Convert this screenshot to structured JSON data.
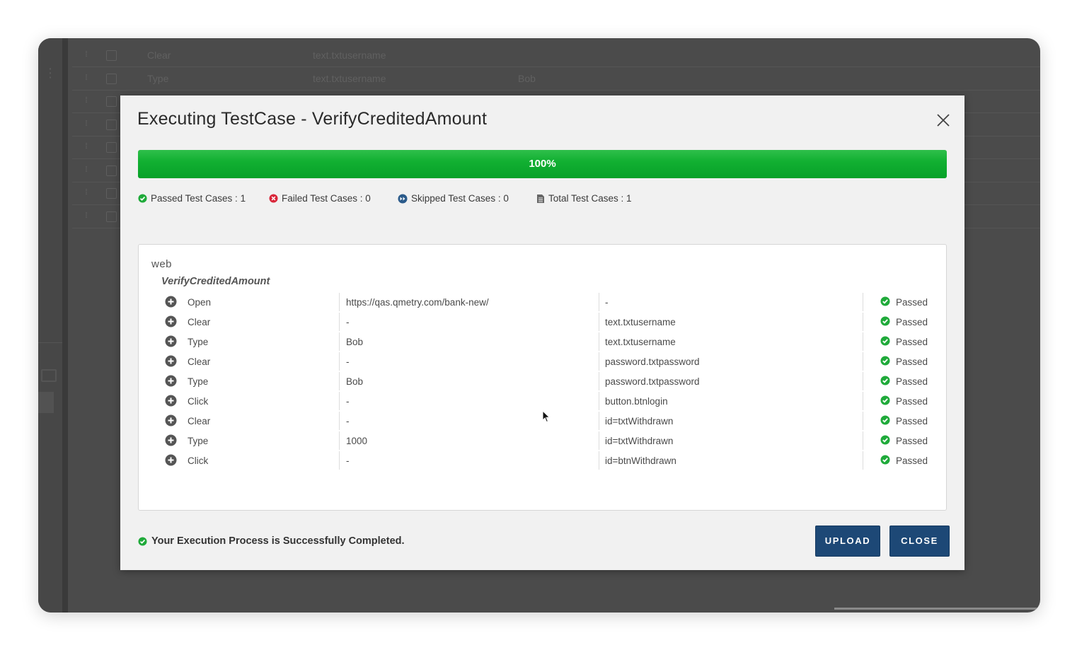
{
  "background": {
    "rows": [
      {
        "action": "Clear",
        "locator": "text.txtusername",
        "value": ""
      },
      {
        "action": "Type",
        "locator": "text.txtusername",
        "value": "Bob"
      },
      {
        "action": "",
        "locator": "",
        "value": ""
      },
      {
        "action": "",
        "locator": "",
        "value": ""
      },
      {
        "action": "",
        "locator": "",
        "value": ""
      },
      {
        "action": "",
        "locator": "",
        "value": ""
      },
      {
        "action": "",
        "locator": "",
        "value": ""
      },
      {
        "action": "",
        "locator": "",
        "value": ""
      }
    ]
  },
  "modal": {
    "title": "Executing TestCase - VerifyCreditedAmount",
    "progress": {
      "percent": 100,
      "label": "100%",
      "color": "#12b032"
    },
    "stats": {
      "passed": "Passed Test Cases : 1",
      "failed": "Failed Test Cases : 0",
      "skipped": "Skipped Test Cases : 0",
      "total": "Total Test Cases : 1"
    },
    "results": {
      "suite": "web",
      "testcase": "VerifyCreditedAmount",
      "steps": [
        {
          "action": "Open",
          "value": "https://qas.qmetry.com/bank-new/",
          "locator": "-",
          "status": "Passed"
        },
        {
          "action": "Clear",
          "value": "-",
          "locator": "text.txtusername",
          "status": "Passed"
        },
        {
          "action": "Type",
          "value": "Bob",
          "locator": "text.txtusername",
          "status": "Passed"
        },
        {
          "action": "Clear",
          "value": "-",
          "locator": "password.txtpassword",
          "status": "Passed"
        },
        {
          "action": "Type",
          "value": "Bob",
          "locator": "password.txtpassword",
          "status": "Passed"
        },
        {
          "action": "Click",
          "value": "-",
          "locator": "button.btnlogin",
          "status": "Passed"
        },
        {
          "action": "Clear",
          "value": "-",
          "locator": "id=txtWithdrawn",
          "status": "Passed"
        },
        {
          "action": "Type",
          "value": "1000",
          "locator": "id=txtWithdrawn",
          "status": "Passed"
        },
        {
          "action": "Click",
          "value": "-",
          "locator": "id=btnWithdrawn",
          "status": "Passed"
        }
      ]
    },
    "footer": {
      "message": "Your Execution Process is Successfully Completed.",
      "upload_label": "UPLOAD",
      "close_label": "CLOSE"
    }
  },
  "colors": {
    "primary_button": "#1d4876",
    "success": "#1faa3a",
    "failed": "#d9263a",
    "skipped": "#2a5a8a"
  },
  "icons": [
    "close-icon",
    "passed-check-icon",
    "failed-x-icon",
    "skipped-icon",
    "document-icon",
    "expand-plus-icon",
    "mouse-cursor-icon"
  ]
}
